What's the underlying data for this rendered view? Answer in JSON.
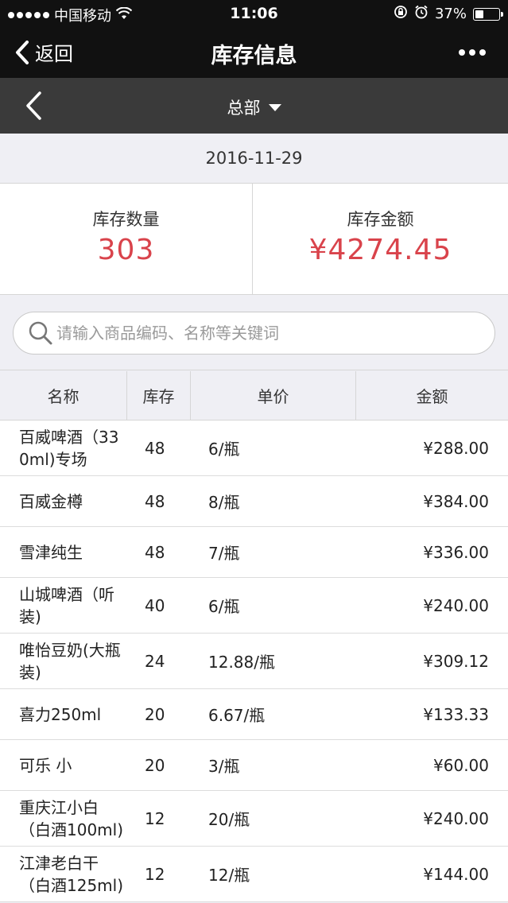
{
  "status": {
    "carrier": "中国移动",
    "time": "11:06",
    "battery": "37%",
    "battery_level": 0.37
  },
  "nav": {
    "back_label": "返回",
    "title": "库存信息"
  },
  "branch": "总部",
  "date": "2016-11-29",
  "stats": {
    "qty_label": "库存数量",
    "qty_value": "303",
    "amount_label": "库存金额",
    "amount_value": "¥4274.45"
  },
  "search": {
    "placeholder": "请输入商品编码、名称等关键词"
  },
  "table": {
    "headers": [
      "名称",
      "库存",
      "单价",
      "金额"
    ],
    "rows": [
      {
        "name": "百威啤酒（330ml)专场",
        "qty": "48",
        "price": "6/瓶",
        "amount": "¥288.00"
      },
      {
        "name": "百威金樽",
        "qty": "48",
        "price": "8/瓶",
        "amount": "¥384.00"
      },
      {
        "name": "雪津纯生",
        "qty": "48",
        "price": "7/瓶",
        "amount": "¥336.00"
      },
      {
        "name": "山城啤酒（听装)",
        "qty": "40",
        "price": "6/瓶",
        "amount": "¥240.00"
      },
      {
        "name": "唯怡豆奶(大瓶装)",
        "qty": "24",
        "price": "12.88/瓶",
        "amount": "¥309.12"
      },
      {
        "name": "喜力250ml",
        "qty": "20",
        "price": "6.67/瓶",
        "amount": "¥133.33"
      },
      {
        "name": "可乐 小",
        "qty": "20",
        "price": "3/瓶",
        "amount": "¥60.00"
      },
      {
        "name": "重庆江小白（白酒100ml)",
        "qty": "12",
        "price": "20/瓶",
        "amount": "¥240.00"
      },
      {
        "name": "江津老白干（白酒125ml)",
        "qty": "12",
        "price": "12/瓶",
        "amount": "¥144.00"
      }
    ]
  },
  "colors": {
    "accent_red": "#d9434b",
    "nav_bg": "#111111",
    "subbar_bg": "#3a3a3a"
  }
}
